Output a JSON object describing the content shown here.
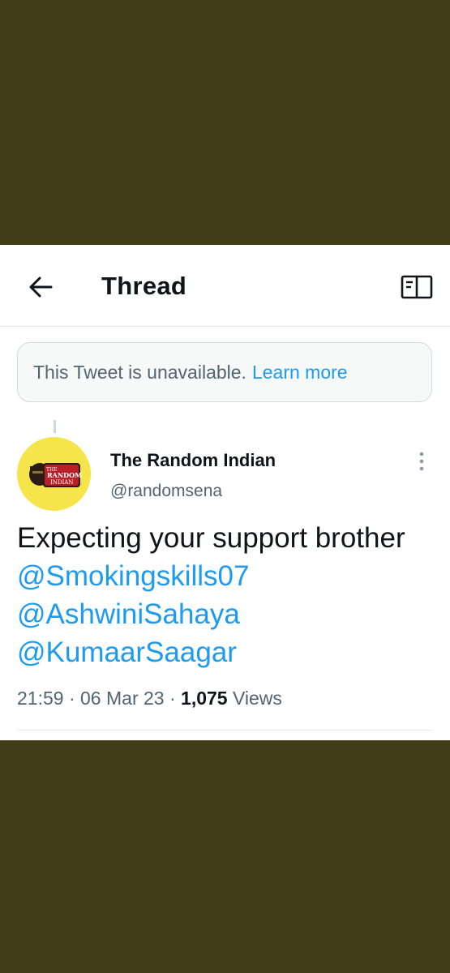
{
  "header": {
    "title": "Thread",
    "back_icon": "arrow-left-icon",
    "reader_icon": "book-open-icon"
  },
  "notice": {
    "text": "This Tweet is unavailable.",
    "link": "Learn more"
  },
  "tweet": {
    "avatar_text": [
      "THE",
      "RANDOM",
      "INDIAN"
    ],
    "author_name": "The Random Indian",
    "author_handle": "@randomsena",
    "text_plain": "Expecting your support brother",
    "mentions": [
      "@Smokingskills07",
      "@AshwiniSahaya",
      "@KumaarSaagar"
    ],
    "time": "21:59",
    "date": "06 Mar 23",
    "views_count": "1,075",
    "views_label": "Views",
    "separator": "·"
  },
  "colors": {
    "background": "#413d17",
    "card": "#ffffff",
    "accent": "#1d9bf0",
    "text": "#0f1419",
    "muted": "#536471",
    "avatar": "#f6e54a"
  }
}
